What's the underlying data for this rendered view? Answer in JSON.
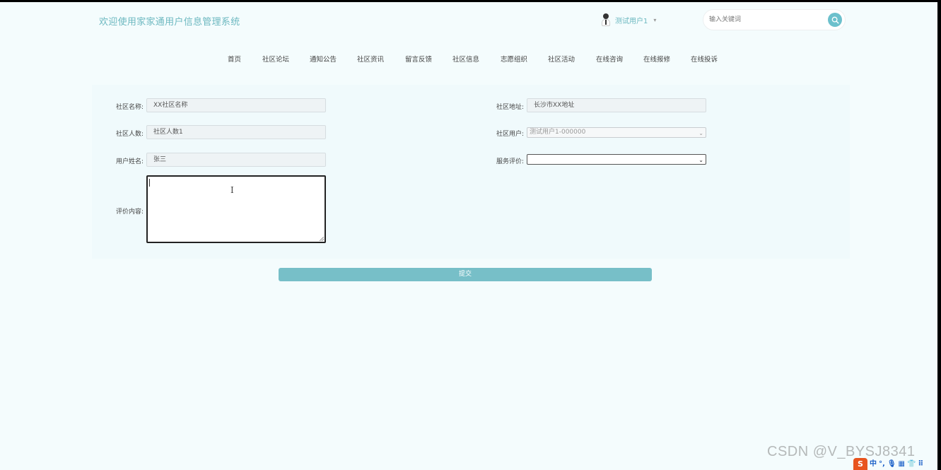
{
  "header": {
    "site_title": "欢迎使用家家通用户信息管理系统",
    "user_name": "测试用户1",
    "user_caret": "▾",
    "search_placeholder": "输入关键词"
  },
  "nav": {
    "items": [
      "首页",
      "社区论坛",
      "通知公告",
      "社区资讯",
      "留言反馈",
      "社区信息",
      "志愿组织",
      "社区活动",
      "在线咨询",
      "在线报修",
      "在线投诉"
    ]
  },
  "form": {
    "community_name_label": "社区名称:",
    "community_name_value": "XX社区名称",
    "community_address_label": "社区地址:",
    "community_address_value": "长沙市XX地址",
    "community_population_label": "社区人数:",
    "community_population_value": "社区人数1",
    "community_user_label": "社区用户:",
    "community_user_value": "测试用户1-000000",
    "user_real_name_label": "用户姓名:",
    "user_real_name_value": "张三",
    "service_rating_label": "服务评价:",
    "service_rating_value": "",
    "review_content_label": "评价内容:",
    "review_content_value": "",
    "submit_label": "提交"
  },
  "overlay": {
    "watermark": "CSDN @V_BYSJ8341",
    "ime_logo": "S",
    "ime_items": [
      "中",
      "°,",
      "🎙",
      "▦",
      "👕",
      "⠿"
    ]
  },
  "colors": {
    "accent": "#6cb8c0",
    "button": "#77bfc8",
    "background": "#f4fcfd"
  }
}
